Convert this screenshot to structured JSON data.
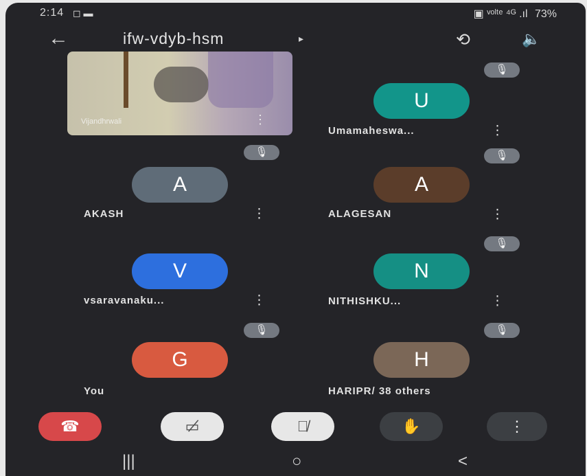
{
  "status_bar": {
    "time": "2:14",
    "left_icons": "◻ ▬",
    "right_icons": "▣ ᵛᵒˡᵗᵉ ⁴ᴳ .ıl",
    "battery": "73%"
  },
  "header": {
    "meeting_code": "ifw-vdyb-hsm",
    "back_icon": "arrow-left-icon",
    "caret": "▸",
    "switch_camera_icon": "camera-switch-icon",
    "speaker_icon": "speaker-icon"
  },
  "participants": [
    {
      "initial": "U",
      "name": "Umamaheswa...",
      "color": "#12958a",
      "muted": true
    },
    {
      "initial": "A",
      "name": "AKASH",
      "color": "#5f6c78",
      "muted": true
    },
    {
      "initial": "A",
      "name": "ALAGESAN",
      "color": "#5b3d2a",
      "muted": true
    },
    {
      "initial": "V",
      "name": "vsaravanaku...",
      "color": "#2d6fde",
      "muted": false
    },
    {
      "initial": "N",
      "name": "NITHISHKU...",
      "color": "#158f84",
      "muted": true
    },
    {
      "initial": "G",
      "name": "You",
      "color": "#d85a40",
      "muted": true
    },
    {
      "initial": "H",
      "name": "HARIPR/ 38 others",
      "color": "#7b6757",
      "muted": true
    }
  ],
  "self_video": {
    "label": "Vijandhrwali"
  },
  "controls": {
    "end_call_color": "#d7484a",
    "camera_off_icon": "camera-off-icon",
    "mic_off_icon": "mic-off-icon",
    "hand_icon": "raise-hand-icon",
    "more_icon": "more-vertical-icon"
  },
  "nav": {
    "recent_icon": "|||",
    "home_icon": "○",
    "back_icon": "<"
  }
}
